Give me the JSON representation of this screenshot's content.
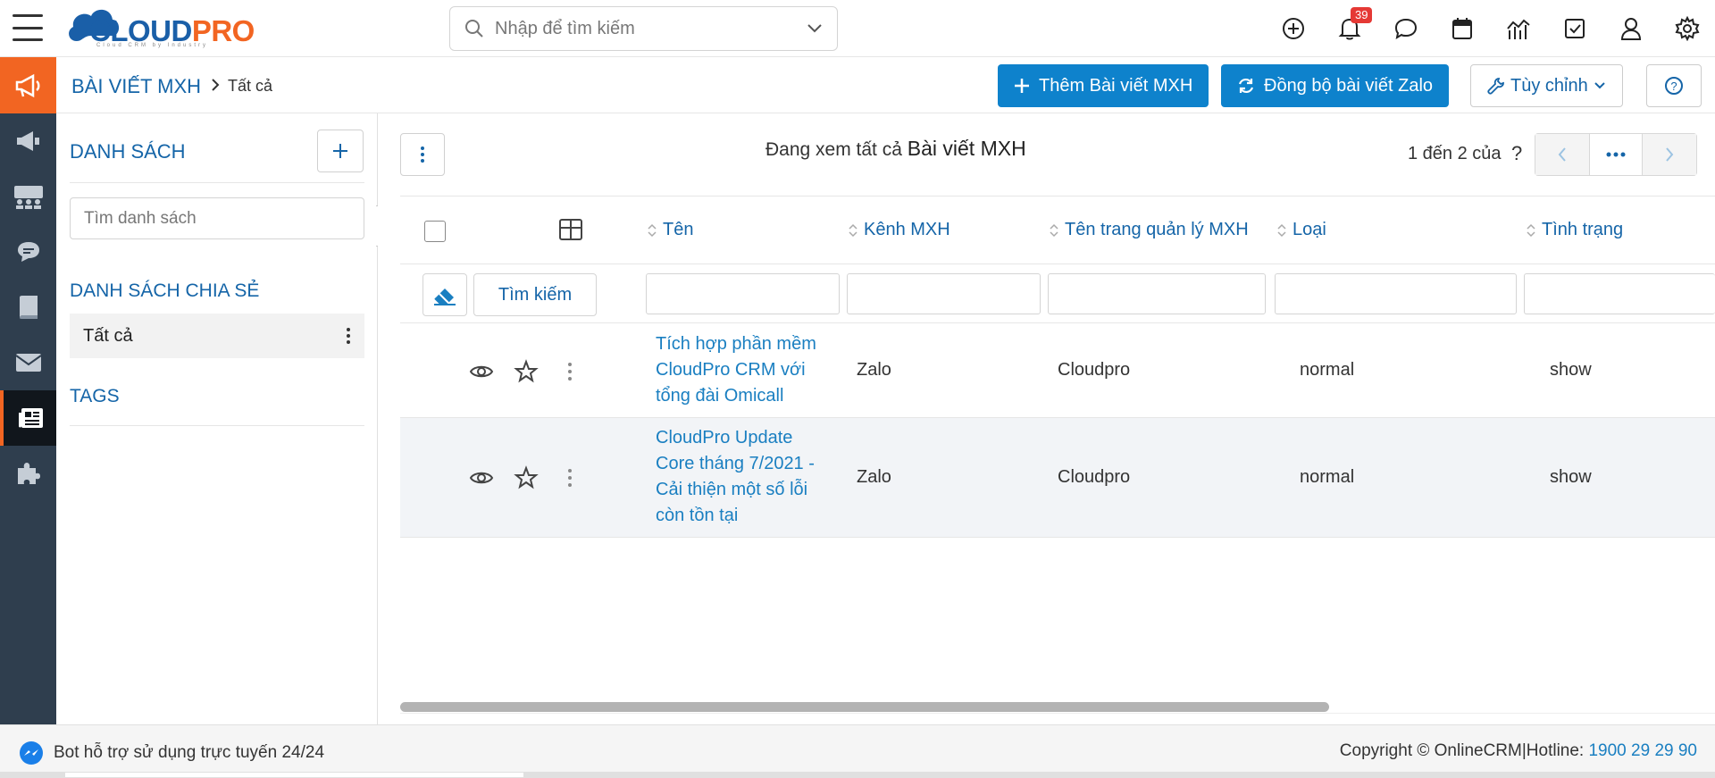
{
  "header": {
    "logo_main": "CLOUD",
    "logo_accent": "PRO",
    "logo_tagline": "Cloud CRM by Industry",
    "search_placeholder": "Nhập để tìm kiếm",
    "notification_count": "39",
    "icons": [
      "plus-circle-icon",
      "bell-icon",
      "chat-icon",
      "calendar-icon",
      "chart-icon",
      "task-icon",
      "user-icon",
      "gear-icon"
    ]
  },
  "sidebar": {
    "items": [
      "megaphone-icon",
      "megaphone-icon",
      "people-icon",
      "chat-bubble-icon",
      "book-icon",
      "mail-icon",
      "newspaper-icon",
      "puzzle-icon"
    ],
    "active_index": 6
  },
  "breadcrumb": {
    "module": "BÀI VIẾT MXH",
    "current": "Tất cả"
  },
  "actions": {
    "add_label": "Thêm Bài viết MXH",
    "sync_label": "Đồng bộ bài viết Zalo",
    "customize_label": "Tùy chỉnh",
    "help": "?"
  },
  "list_panel": {
    "title": "DANH SÁCH",
    "search_placeholder": "Tìm danh sách",
    "shared_title": "DANH SÁCH CHIA SẺ",
    "shared_items": [
      {
        "label": "Tất cả"
      }
    ],
    "tags_title": "TAGS"
  },
  "main": {
    "viewing_prefix": "Đang xem tất cả",
    "viewing_module": "Bài viết MXH",
    "pager_text": "1 đến 2 của",
    "pager_q": "?",
    "search_button": "Tìm kiếm",
    "columns": [
      "Tên",
      "Kênh MXH",
      "Tên trang quản lý MXH",
      "Loại",
      "Tình trạng"
    ],
    "rows": [
      {
        "name": "Tích hợp phần mềm CloudPro CRM với tổng đài Omicall",
        "channel": "Zalo",
        "page": "Cloudpro",
        "type": "normal",
        "status": "show"
      },
      {
        "name": "CloudPro Update Core tháng 7/2021 - Cải thiện một số lỗi còn tồn tại",
        "channel": "Zalo",
        "page": "Cloudpro",
        "type": "normal",
        "status": "show"
      }
    ]
  },
  "footer": {
    "bot_text": "Bot hỗ trợ sử dụng trực tuyến 24/24",
    "copyright": "Copyright © OnlineCRM|Hotline: ",
    "hotline": "1900 29 29 90"
  },
  "colors": {
    "primary_blue": "#0e82cc",
    "link_blue": "#1565a8",
    "accent_orange": "#f26522",
    "sidebar_bg": "#2f3e4e"
  }
}
